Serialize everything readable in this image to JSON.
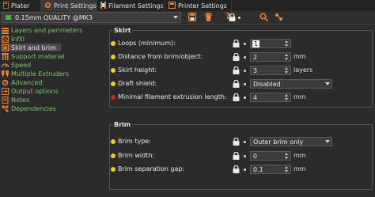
{
  "tabs": [
    {
      "label": "Plater",
      "icon": "plater-icon",
      "active": false
    },
    {
      "label": "Print Settings",
      "icon": "gear-icon",
      "active": true
    },
    {
      "label": "Filament Settings",
      "icon": "filament-spool-icon",
      "active": false
    },
    {
      "label": "Printer Settings",
      "icon": "printer-icon",
      "active": false
    }
  ],
  "toolbar": {
    "preset": "0.15mm QUALITY @MK3",
    "help_glyph": "?"
  },
  "sidebar": {
    "items": [
      {
        "label": "Layers and perimeters",
        "icon": "layers-icon"
      },
      {
        "label": "Infill",
        "icon": "infill-icon"
      },
      {
        "label": "Skirt and brim",
        "icon": "skirt-icon",
        "selected": true
      },
      {
        "label": "Support material",
        "icon": "support-icon"
      },
      {
        "label": "Speed",
        "icon": "speed-icon"
      },
      {
        "label": "Multiple Extruders",
        "icon": "extruders-icon"
      },
      {
        "label": "Advanced",
        "icon": "advanced-icon"
      },
      {
        "label": "Output options",
        "icon": "output-icon"
      },
      {
        "label": "Notes",
        "icon": "notes-icon"
      },
      {
        "label": "Dependencies",
        "icon": "dependencies-icon"
      }
    ]
  },
  "skirt": {
    "title": "Skirt",
    "loops_label": "Loops (minimum):",
    "loops_value": "1",
    "distance_label": "Distance from brim/object:",
    "distance_value": "2",
    "distance_unit": "mm",
    "height_label": "Skirt height:",
    "height_value": "3",
    "height_unit": "layers",
    "draft_label": "Draft shield:",
    "draft_value": "Disabled",
    "min_extrusion_label": "Minimal filament extrusion length:",
    "min_extrusion_value": "4",
    "min_extrusion_unit": "mm"
  },
  "brim": {
    "title": "Brim",
    "type_label": "Brim type:",
    "type_value": "Outer brim only",
    "width_label": "Brim width:",
    "width_value": "0",
    "width_unit": "mm",
    "gap_label": "Brim separation gap:",
    "gap_value": "0.1",
    "gap_unit": "mm"
  },
  "colors": {
    "accent": "#e8813a",
    "nav_text": "#7dc66a",
    "dot_simple": "#e8d21c",
    "dot_expert": "#cc2222"
  }
}
